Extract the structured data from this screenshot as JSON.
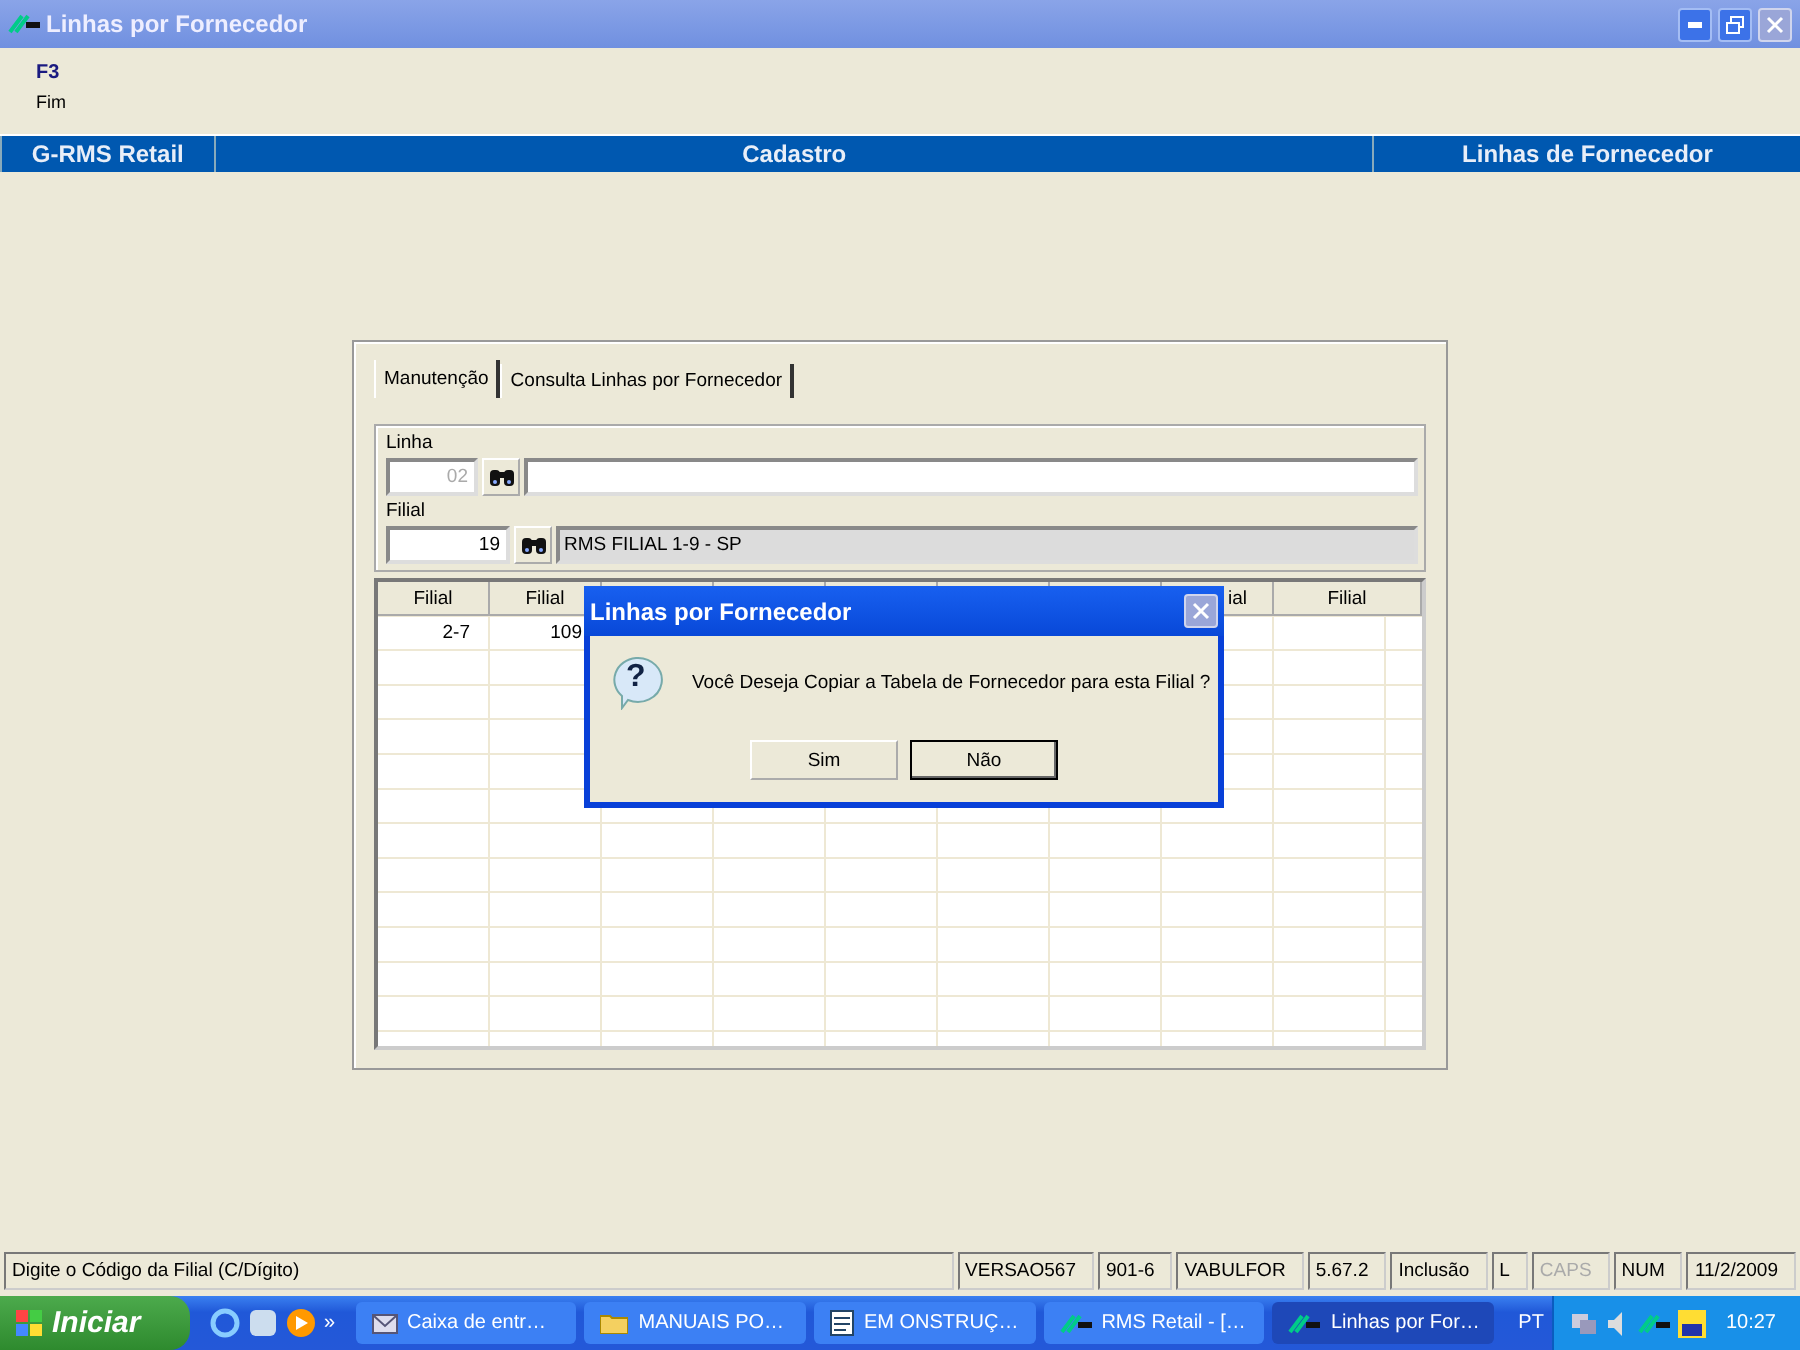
{
  "window": {
    "title": "Linhas por Fornecedor"
  },
  "menu": {
    "key": "F3",
    "label": "Fim"
  },
  "header_bar": [
    "G-RMS Retail",
    "Cadastro",
    "Linhas de Fornecedor"
  ],
  "tabs": [
    {
      "label": "Manutenção",
      "selected": true
    },
    {
      "label": "Consulta Linhas por Fornecedor",
      "selected": false
    }
  ],
  "linha": {
    "label": "Linha",
    "code": "02",
    "disabled": true
  },
  "filial": {
    "label": "Filial",
    "code": "19",
    "disabled": false,
    "description": "RMS FILIAL 1-9 - SP"
  },
  "grid": {
    "columns": [
      {
        "label": "Filial"
      },
      {
        "label": "Filial"
      },
      {},
      {},
      {},
      {},
      {},
      {
        "label": "ial",
        "clipped": true
      },
      {
        "label": "Filial"
      }
    ],
    "rows": [
      [
        "2-7",
        "109"
      ]
    ]
  },
  "dialog": {
    "title": "Linhas por Fornecedor",
    "icon": "?",
    "message": "Você Deseja Copiar a Tabela de Fornecedor para esta Filial ?",
    "buttons": [
      {
        "label": "Sim",
        "selected": false
      },
      {
        "label": "Não",
        "selected": true
      }
    ]
  },
  "status_bar": [
    {
      "text": "Digite o Código da Filial (C/Dígito)",
      "disabled": false
    },
    {
      "text": "VERSAO567",
      "disabled": false
    },
    {
      "text": "901-6",
      "disabled": false
    },
    {
      "text": "VABULFOR",
      "disabled": false
    },
    {
      "text": "5.67.2",
      "disabled": false
    },
    {
      "text": "Inclusão",
      "disabled": false
    },
    {
      "text": "L",
      "disabled": false
    },
    {
      "text": "CAPS",
      "disabled": true
    },
    {
      "text": "NUM",
      "disabled": false
    },
    {
      "text": "11/2/2009",
      "disabled": false
    }
  ],
  "taskbar": {
    "start": "Iniciar",
    "overflow": "»",
    "tasks": [
      {
        "label": "Caixa de entr…",
        "kind": "mail",
        "selected": false
      },
      {
        "label": "MANUAIS PO…",
        "kind": "folder",
        "selected": false
      },
      {
        "label": "EM ONSTRUÇ…",
        "kind": "doc",
        "selected": false
      },
      {
        "label": "RMS Retail - […",
        "kind": "rms",
        "selected": false
      },
      {
        "label": "Linhas por For…",
        "kind": "rms",
        "selected": true
      }
    ],
    "language": "PT",
    "clock": "10:27"
  }
}
